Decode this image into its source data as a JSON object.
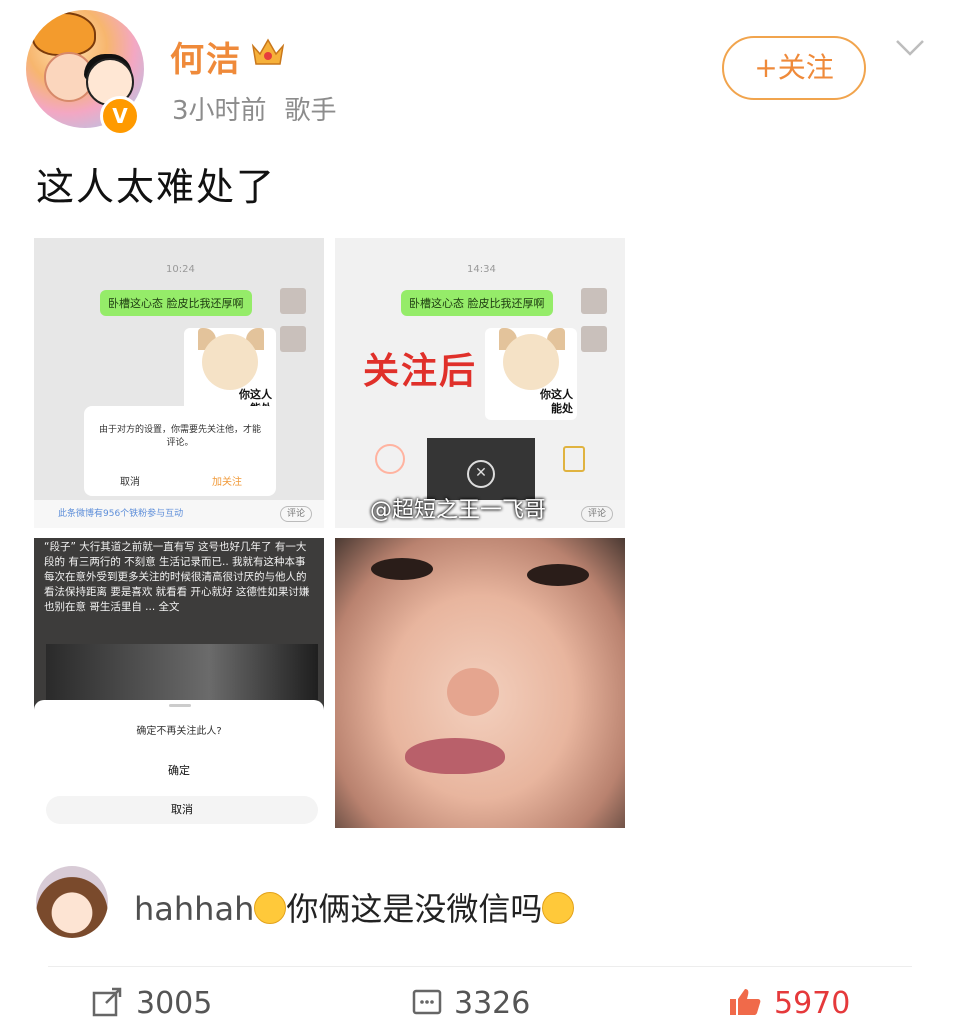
{
  "post": {
    "author": "何洁",
    "time": "3小时前",
    "tag": "歌手",
    "follow_label": "+关注",
    "text": "这人太难处了"
  },
  "images": {
    "tile1": {
      "bubble": "卧槽这心态 脸皮比我还厚啊",
      "time": "10:24",
      "dog_label_1": "你这人",
      "dog_label_2": "能处",
      "dialog_message": "由于对方的设置，你需要先关注他，才能评论。",
      "dialog_cancel": "取消",
      "dialog_confirm": "加关注",
      "footer": "此条微博有956个铁粉参与互动",
      "footer_btn": "评论"
    },
    "tile2": {
      "time": "14:34",
      "bubble": "卧槽这心态 脸皮比我还厚啊",
      "overlay": "关注后",
      "dog_label_1": "你这人",
      "dog_label_2": "能处",
      "footer_btn": "评论"
    },
    "watermark": "@超短之王一飞哥",
    "tile3": {
      "text": "“段子” 大行其道之前就一直有写 这号也好几年了 有一大段的 有三两行的 不刻意 生活记录而已.. 我就有这种本事 每次在意外受到更多关注的时候很清高很讨厌的与他人的看法保持距离 要是喜欢 就看看 开心就好 这德性如果讨嫌 也别在意 哥生活里自 ... 全文",
      "sheet_question": "确定不再关注此人?",
      "sheet_confirm": "确定",
      "sheet_cancel": "取消"
    }
  },
  "comment": {
    "user": "hahhah",
    "text": "你俩这是没微信吗"
  },
  "actions": {
    "repost": "3005",
    "comments": "3326",
    "likes": "5970"
  },
  "colors": {
    "accent": "#ef8a3a",
    "like": "#e5393b"
  }
}
